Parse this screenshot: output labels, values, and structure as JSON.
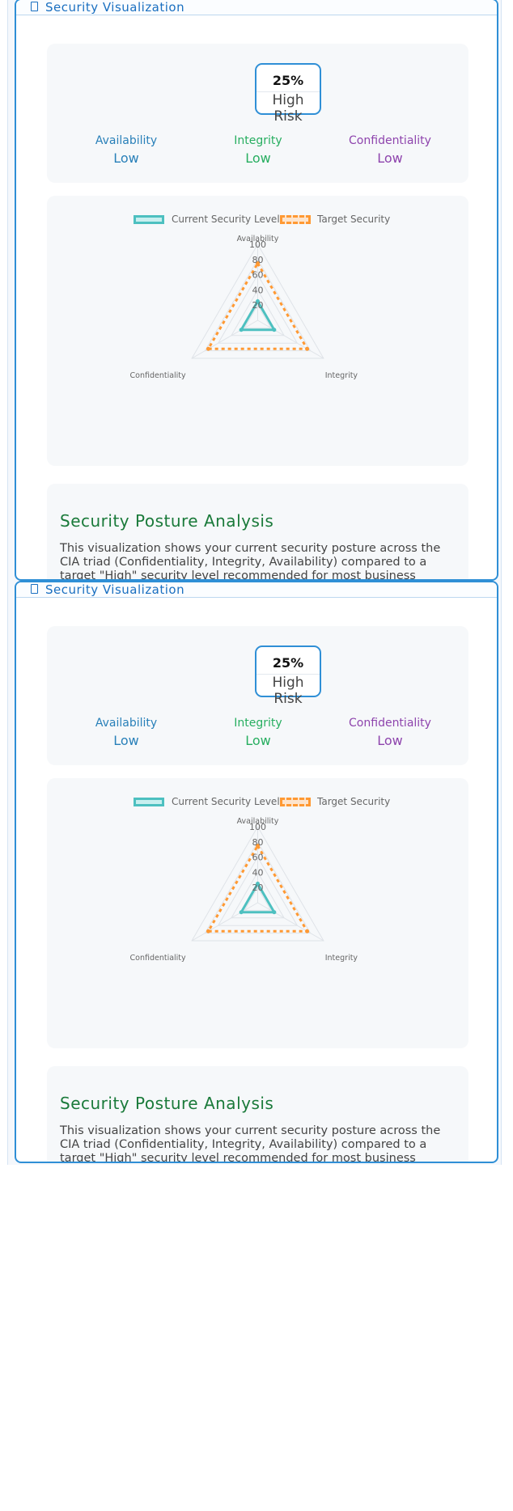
{
  "panels": [
    {
      "title": "Security Visualization",
      "risk": {
        "percent": "25%",
        "level": "High Risk"
      },
      "cia": [
        {
          "label": "Availability",
          "value": "Low",
          "color": "#2980b9"
        },
        {
          "label": "Integrity",
          "value": "Low",
          "color": "#27ae60"
        },
        {
          "label": "Confidentiality",
          "value": "Low",
          "color": "#8e44ad"
        }
      ],
      "analysis": {
        "title": "Security Posture Analysis",
        "text": "This visualization shows your current security posture across the CIA triad (Confidentiality, Integrity, Availability) compared to a target \"High\" security level recommended for most business applications."
      }
    },
    {
      "title": "Security Visualization",
      "risk": {
        "percent": "25%",
        "level": "High Risk"
      },
      "cia": [
        {
          "label": "Availability",
          "value": "Low",
          "color": "#2980b9"
        },
        {
          "label": "Integrity",
          "value": "Low",
          "color": "#27ae60"
        },
        {
          "label": "Confidentiality",
          "value": "Low",
          "color": "#8e44ad"
        }
      ],
      "analysis": {
        "title": "Security Posture Analysis",
        "text": "This visualization shows your current security posture across the CIA triad (Confidentiality, Integrity, Availability) compared to a target \"High\" security level recommended for most business applications."
      }
    }
  ],
  "chart_data": {
    "type": "radar",
    "axes": [
      "Availability",
      "Integrity",
      "Confidentiality"
    ],
    "ticks": [
      20,
      40,
      60,
      80,
      100
    ],
    "range": [
      0,
      100
    ],
    "series": [
      {
        "name": "Current Security Levels",
        "values": [
          25,
          25,
          25
        ],
        "color": "#4dc0c0",
        "style": "solid"
      },
      {
        "name": "Target Security",
        "values": [
          75,
          75,
          75
        ],
        "color": "#ff9933",
        "style": "dashed"
      }
    ]
  },
  "icons": {
    "header": "shield-icon"
  }
}
